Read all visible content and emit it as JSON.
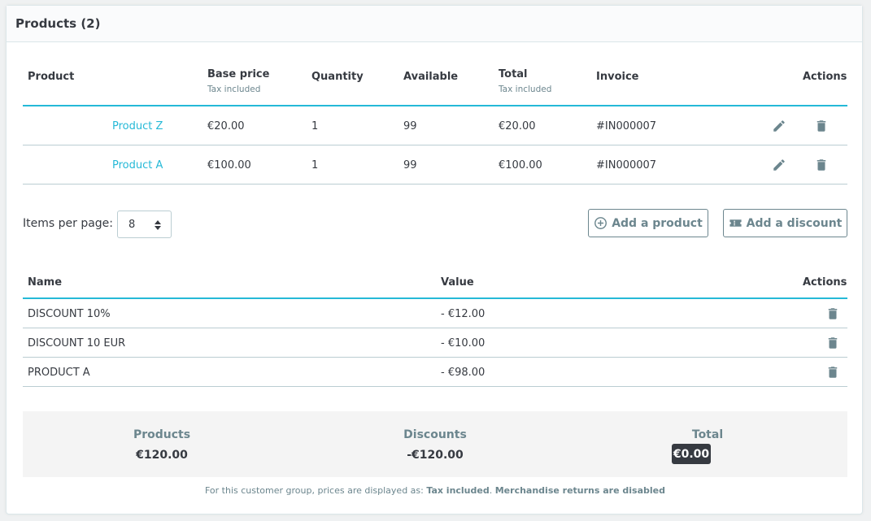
{
  "card": {
    "title": "Products (2)"
  },
  "products_table": {
    "headers": {
      "product": "Product",
      "base_price": "Base price",
      "base_price_sub": "Tax included",
      "quantity": "Quantity",
      "available": "Available",
      "total": "Total",
      "total_sub": "Tax included",
      "invoice": "Invoice",
      "actions": "Actions"
    },
    "rows": [
      {
        "name": "Product Z",
        "base_price": "€20.00",
        "quantity": "1",
        "available": "99",
        "total": "€20.00",
        "invoice": "#IN000007"
      },
      {
        "name": "Product A",
        "base_price": "€100.00",
        "quantity": "1",
        "available": "99",
        "total": "€100.00",
        "invoice": "#IN000007"
      }
    ]
  },
  "pagination": {
    "label": "Items per page:",
    "value": "8"
  },
  "buttons": {
    "add_product": "Add a product",
    "add_discount": "Add a discount"
  },
  "discounts_table": {
    "headers": {
      "name": "Name",
      "value": "Value",
      "actions": "Actions"
    },
    "rows": [
      {
        "name": "DISCOUNT 10%",
        "value": "- €12.00"
      },
      {
        "name": "DISCOUNT 10 EUR",
        "value": "- €10.00"
      },
      {
        "name": "PRODUCT A",
        "value": "- €98.00"
      }
    ]
  },
  "summary": {
    "products_label": "Products",
    "products_value": "€120.00",
    "discounts_label": "Discounts",
    "discounts_value": "-€120.00",
    "total_label": "Total",
    "total_value": "€0.00"
  },
  "footnote": {
    "text": "For this customer group, prices are displayed as:",
    "tax": "Tax included",
    "returns": "Merchandise returns are disabled"
  },
  "colors": {
    "accent": "#25b9d7",
    "text": "#363a41",
    "muted": "#6c868e"
  },
  "icons": {
    "edit": "pencil-icon",
    "delete": "trash-icon",
    "add": "plus-circle-icon",
    "discount": "ticket-icon"
  }
}
